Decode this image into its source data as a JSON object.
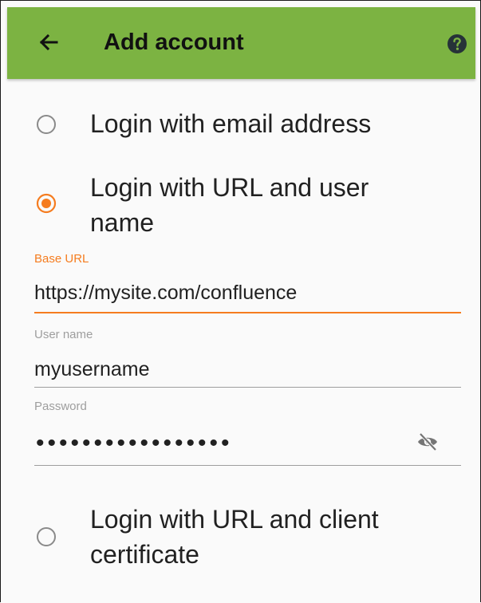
{
  "appbar": {
    "title": "Add account",
    "back_icon": "arrow-left-icon",
    "help_icon": "help-circle-icon",
    "background": "#7cb342"
  },
  "options": [
    {
      "label": "Login with email address",
      "selected": false
    },
    {
      "label": "Login with URL and user name",
      "selected": true
    },
    {
      "label": "Login with URL and client certificate",
      "selected": false
    }
  ],
  "form": {
    "base_url": {
      "label": "Base URL",
      "value": "https://mysite.com/confluence"
    },
    "username": {
      "label": "User name",
      "value": "myusername"
    },
    "password": {
      "label": "Password",
      "masked_value": "•••••••••••••••••"
    }
  },
  "colors": {
    "accent": "#f57c1f",
    "hint": "#9e9e9e"
  }
}
